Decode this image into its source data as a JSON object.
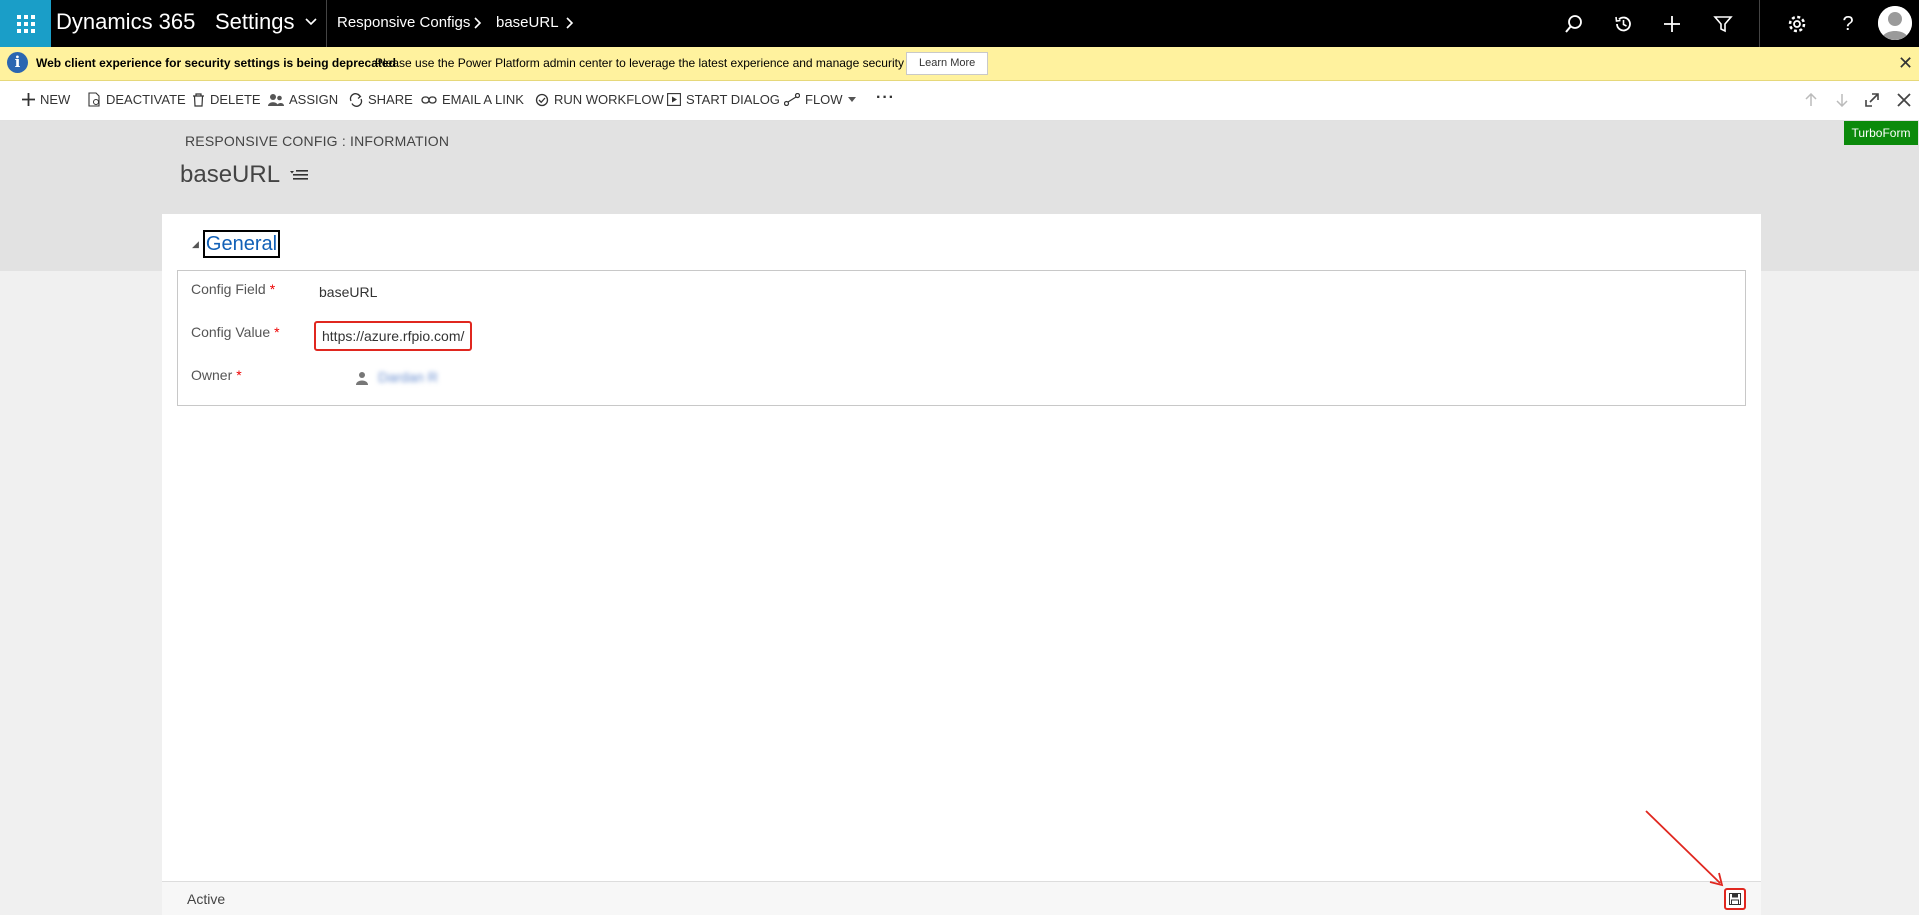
{
  "topbar": {
    "app_name": "Dynamics 365",
    "module": "Settings",
    "breadcrumb": [
      "Responsive Configs",
      "baseURL"
    ]
  },
  "notice": {
    "title": "Web client experience for security settings is being deprecated",
    "message": "Please use the Power Platform admin center to leverage the latest experience and manage security settings",
    "button_label": "Learn More"
  },
  "commands": {
    "new": "NEW",
    "deactivate": "DEACTIVATE",
    "delete": "DELETE",
    "assign": "ASSIGN",
    "share": "SHARE",
    "email_link": "EMAIL A LINK",
    "run_workflow": "RUN WORKFLOW",
    "start_dialog": "START DIALOG",
    "flow": "FLOW"
  },
  "header": {
    "entity_label": "RESPONSIVE CONFIG : INFORMATION",
    "record_title": "baseURL",
    "turboform_label": "TurboForm"
  },
  "form": {
    "section_title": "General",
    "fields": [
      {
        "label": "Config Field",
        "value": "baseURL"
      },
      {
        "label": "Config Value",
        "value": "https://azure.rfpio.com/"
      },
      {
        "label": "Owner",
        "value": "Dardan R"
      }
    ],
    "required_mark": "*"
  },
  "footer": {
    "status": "Active"
  },
  "colors": {
    "waffle_bg": "#1a9ec8",
    "notice_bg": "#fff29e",
    "turboform_bg": "#0b8a0b",
    "highlight": "#e0271f",
    "link": "#1160b7"
  }
}
